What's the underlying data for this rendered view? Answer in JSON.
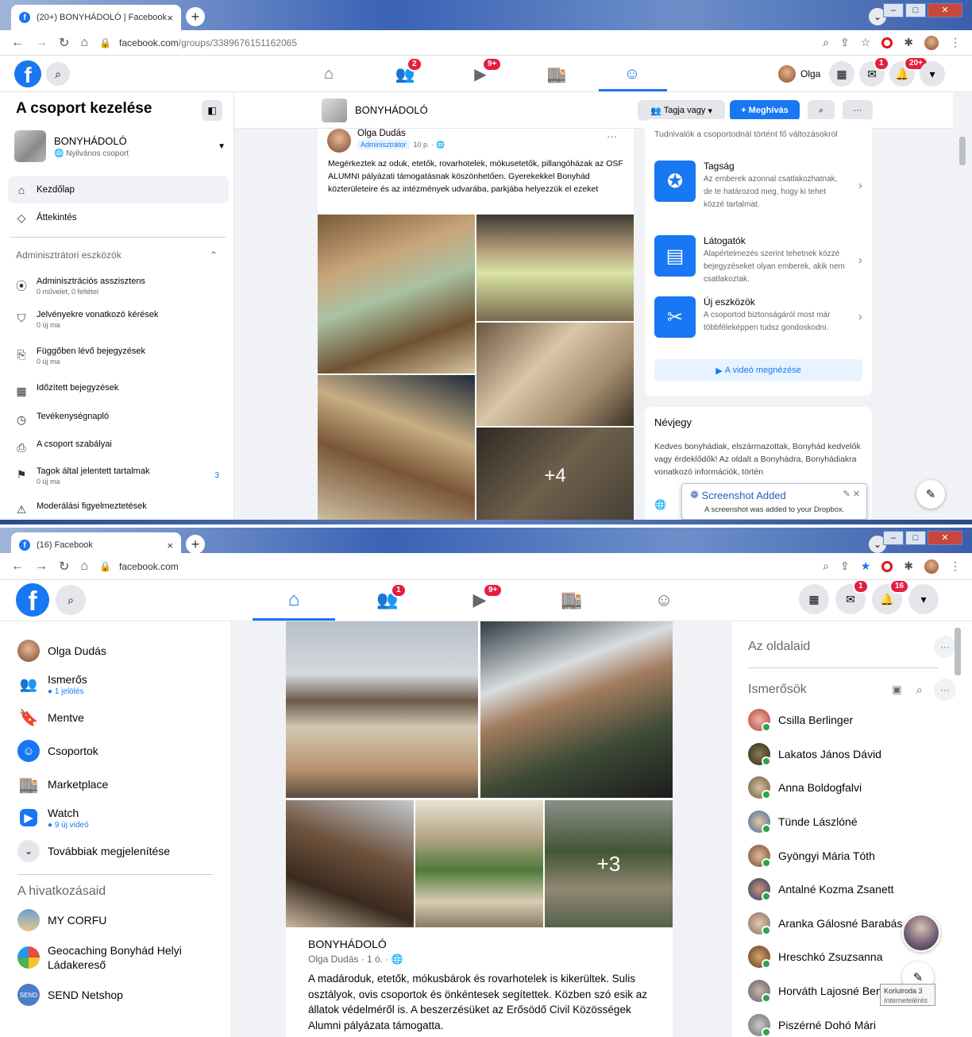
{
  "s1": {
    "browser": {
      "tab_title": "(20+) BONYHÁDOLÓ | Facebook",
      "url_host": "facebook.com",
      "url_path": "/groups/3389676151162065"
    },
    "header": {
      "user_name": "Olga",
      "badges": {
        "friends": "2",
        "watch": "9+",
        "messenger": "1",
        "notifications": "20+"
      }
    },
    "sidebar": {
      "title": "A csoport kezelése",
      "group_name": "BONYHÁDOLÓ",
      "group_type": "Nyilvános csoport",
      "nav": [
        "Kezdőlap",
        "Áttekintés"
      ],
      "tools_heading": "Adminisztrátori eszközök",
      "tools": [
        {
          "label": "Adminisztrációs asszisztens",
          "sub": "0 művelet, 0 feltétel"
        },
        {
          "label": "Jelvényekre vonatkozó kérések",
          "sub": "0 új ma"
        },
        {
          "label": "Függőben lévő bejegyzések",
          "sub": "0 új ma"
        },
        {
          "label": "Időzített bejegyzések",
          "sub": ""
        },
        {
          "label": "Tevékenységnapló",
          "sub": ""
        },
        {
          "label": "A csoport szabályai",
          "sub": ""
        },
        {
          "label": "Tagok által jelentett tartalmak",
          "sub": "0 új ma",
          "count": "3"
        },
        {
          "label": "Moderálási figyelmeztetések",
          "sub": ""
        }
      ]
    },
    "group_header": {
      "name": "BONYHÁDOLÓ",
      "member_button": "Tagja vagy",
      "invite_button": "+ Meghívás"
    },
    "post": {
      "author": "Olga Dudás",
      "role": "Adminisztrátor",
      "time": "10 p. ·",
      "text": "Megérkeztek az oduk, etetők, rovarhotelek, mókusetetők, pillangóházak az OSF ALUMNI pályázati támogatásnak köszönhetően. Gyerekekkel Bonyhád közterületeire és az intézmények udvarába, parkjába helyezzük el ezeket",
      "more_photos": "+4"
    },
    "right_panel": {
      "intro": "Tudnivalók a csoportodnál történt fő változásokról",
      "features": [
        {
          "title": "Tagság",
          "desc": "Az emberek azonnal csatlakozhatnak, de te határozod meg, hogy ki tehet közzé tartalmat."
        },
        {
          "title": "Látogatók",
          "desc": "Alapértelmezés szerint tehetnek közzé bejegyzéseket olyan emberek, akik nem csatlakoztak."
        },
        {
          "title": "Új eszközök",
          "desc": "A csoportod biztonságáról most már többféleképpen tudsz gondoskodni."
        }
      ],
      "video_button": "A videó megnézése",
      "about_title": "Névjegy",
      "about_text": "Kedves bonyhádiak, elszármazottak, Bonyhád kedvelők vagy érdeklődők! Az oldalt a Bonyhádra, Bonyhádiakra vonatkozó információk, történ"
    },
    "toast": {
      "title": "Screenshot Added",
      "text": "A screenshot was added to your Dropbox."
    }
  },
  "s2": {
    "browser": {
      "tab_title": "(16) Facebook",
      "url": "facebook.com"
    },
    "header": {
      "badges": {
        "friends": "1",
        "watch": "9+",
        "messenger": "1",
        "notifications": "16"
      }
    },
    "left": {
      "items": [
        {
          "label": "Olga Dudás",
          "sub": ""
        },
        {
          "label": "Ismerős",
          "sub": "1 jelölés"
        },
        {
          "label": "Mentve",
          "sub": ""
        },
        {
          "label": "Csoportok",
          "sub": ""
        },
        {
          "label": "Marketplace",
          "sub": ""
        },
        {
          "label": "Watch",
          "sub": "9 új videó"
        },
        {
          "label": "Továbbiak megjelenítése",
          "sub": ""
        }
      ],
      "shortcuts_heading": "A hivatkozásaid",
      "shortcuts": [
        "MY CORFU",
        "Geocaching Bonyhád Helyi Ládakereső",
        "SEND Netshop"
      ]
    },
    "post": {
      "more_photos": "+3",
      "group": "BONYHÁDOLÓ",
      "author_time": "Olga Dudás · 1 ó. ·",
      "text": "A madároduk, etetők, mókusbárok és rovarhotelek is kikerültek. Sulis osztályok, ovis csoportok és önkéntesek segítettek. Közben szó esik az állatok védelméről is. A beszerzésüket az Erősödő Civil Közösségek Alumni pályázata támogatta."
    },
    "right": {
      "pages_heading": "Az oldalaid",
      "contacts_heading": "Ismerősök",
      "contacts": [
        "Csilla Berlinger",
        "Lakatos János Dávid",
        "Anna Boldogfalvi",
        "Tünde Lászlóné",
        "Gyöngyi Mária Tóth",
        "Antalné Kozma Zsanett",
        "Aranka Gálosné Barabás",
        "Hreschkó Zsuzsanna",
        "Horváth Lajosné Bencze P...a",
        "Piszérné Dohó Mári"
      ],
      "tray_text": "Korlulroda 3",
      "tray_sub": "Internetelérés"
    }
  }
}
